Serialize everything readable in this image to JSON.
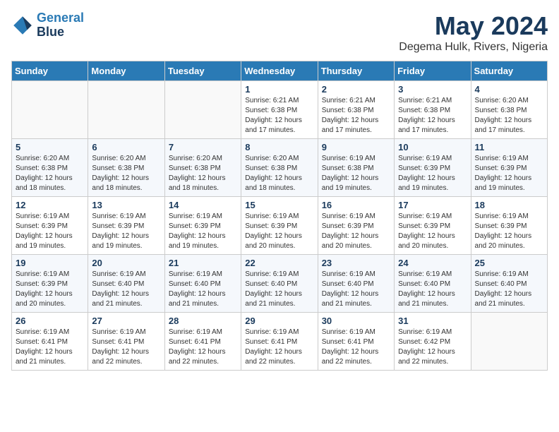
{
  "header": {
    "logo_line1": "General",
    "logo_line2": "Blue",
    "month_year": "May 2024",
    "location": "Degema Hulk, Rivers, Nigeria"
  },
  "weekdays": [
    "Sunday",
    "Monday",
    "Tuesday",
    "Wednesday",
    "Thursday",
    "Friday",
    "Saturday"
  ],
  "weeks": [
    [
      {
        "day": "",
        "info": ""
      },
      {
        "day": "",
        "info": ""
      },
      {
        "day": "",
        "info": ""
      },
      {
        "day": "1",
        "info": "Sunrise: 6:21 AM\nSunset: 6:38 PM\nDaylight: 12 hours\nand 17 minutes."
      },
      {
        "day": "2",
        "info": "Sunrise: 6:21 AM\nSunset: 6:38 PM\nDaylight: 12 hours\nand 17 minutes."
      },
      {
        "day": "3",
        "info": "Sunrise: 6:21 AM\nSunset: 6:38 PM\nDaylight: 12 hours\nand 17 minutes."
      },
      {
        "day": "4",
        "info": "Sunrise: 6:20 AM\nSunset: 6:38 PM\nDaylight: 12 hours\nand 17 minutes."
      }
    ],
    [
      {
        "day": "5",
        "info": "Sunrise: 6:20 AM\nSunset: 6:38 PM\nDaylight: 12 hours\nand 18 minutes."
      },
      {
        "day": "6",
        "info": "Sunrise: 6:20 AM\nSunset: 6:38 PM\nDaylight: 12 hours\nand 18 minutes."
      },
      {
        "day": "7",
        "info": "Sunrise: 6:20 AM\nSunset: 6:38 PM\nDaylight: 12 hours\nand 18 minutes."
      },
      {
        "day": "8",
        "info": "Sunrise: 6:20 AM\nSunset: 6:38 PM\nDaylight: 12 hours\nand 18 minutes."
      },
      {
        "day": "9",
        "info": "Sunrise: 6:19 AM\nSunset: 6:38 PM\nDaylight: 12 hours\nand 19 minutes."
      },
      {
        "day": "10",
        "info": "Sunrise: 6:19 AM\nSunset: 6:39 PM\nDaylight: 12 hours\nand 19 minutes."
      },
      {
        "day": "11",
        "info": "Sunrise: 6:19 AM\nSunset: 6:39 PM\nDaylight: 12 hours\nand 19 minutes."
      }
    ],
    [
      {
        "day": "12",
        "info": "Sunrise: 6:19 AM\nSunset: 6:39 PM\nDaylight: 12 hours\nand 19 minutes."
      },
      {
        "day": "13",
        "info": "Sunrise: 6:19 AM\nSunset: 6:39 PM\nDaylight: 12 hours\nand 19 minutes."
      },
      {
        "day": "14",
        "info": "Sunrise: 6:19 AM\nSunset: 6:39 PM\nDaylight: 12 hours\nand 19 minutes."
      },
      {
        "day": "15",
        "info": "Sunrise: 6:19 AM\nSunset: 6:39 PM\nDaylight: 12 hours\nand 20 minutes."
      },
      {
        "day": "16",
        "info": "Sunrise: 6:19 AM\nSunset: 6:39 PM\nDaylight: 12 hours\nand 20 minutes."
      },
      {
        "day": "17",
        "info": "Sunrise: 6:19 AM\nSunset: 6:39 PM\nDaylight: 12 hours\nand 20 minutes."
      },
      {
        "day": "18",
        "info": "Sunrise: 6:19 AM\nSunset: 6:39 PM\nDaylight: 12 hours\nand 20 minutes."
      }
    ],
    [
      {
        "day": "19",
        "info": "Sunrise: 6:19 AM\nSunset: 6:39 PM\nDaylight: 12 hours\nand 20 minutes."
      },
      {
        "day": "20",
        "info": "Sunrise: 6:19 AM\nSunset: 6:40 PM\nDaylight: 12 hours\nand 21 minutes."
      },
      {
        "day": "21",
        "info": "Sunrise: 6:19 AM\nSunset: 6:40 PM\nDaylight: 12 hours\nand 21 minutes."
      },
      {
        "day": "22",
        "info": "Sunrise: 6:19 AM\nSunset: 6:40 PM\nDaylight: 12 hours\nand 21 minutes."
      },
      {
        "day": "23",
        "info": "Sunrise: 6:19 AM\nSunset: 6:40 PM\nDaylight: 12 hours\nand 21 minutes."
      },
      {
        "day": "24",
        "info": "Sunrise: 6:19 AM\nSunset: 6:40 PM\nDaylight: 12 hours\nand 21 minutes."
      },
      {
        "day": "25",
        "info": "Sunrise: 6:19 AM\nSunset: 6:40 PM\nDaylight: 12 hours\nand 21 minutes."
      }
    ],
    [
      {
        "day": "26",
        "info": "Sunrise: 6:19 AM\nSunset: 6:41 PM\nDaylight: 12 hours\nand 21 minutes."
      },
      {
        "day": "27",
        "info": "Sunrise: 6:19 AM\nSunset: 6:41 PM\nDaylight: 12 hours\nand 22 minutes."
      },
      {
        "day": "28",
        "info": "Sunrise: 6:19 AM\nSunset: 6:41 PM\nDaylight: 12 hours\nand 22 minutes."
      },
      {
        "day": "29",
        "info": "Sunrise: 6:19 AM\nSunset: 6:41 PM\nDaylight: 12 hours\nand 22 minutes."
      },
      {
        "day": "30",
        "info": "Sunrise: 6:19 AM\nSunset: 6:41 PM\nDaylight: 12 hours\nand 22 minutes."
      },
      {
        "day": "31",
        "info": "Sunrise: 6:19 AM\nSunset: 6:42 PM\nDaylight: 12 hours\nand 22 minutes."
      },
      {
        "day": "",
        "info": ""
      }
    ]
  ]
}
